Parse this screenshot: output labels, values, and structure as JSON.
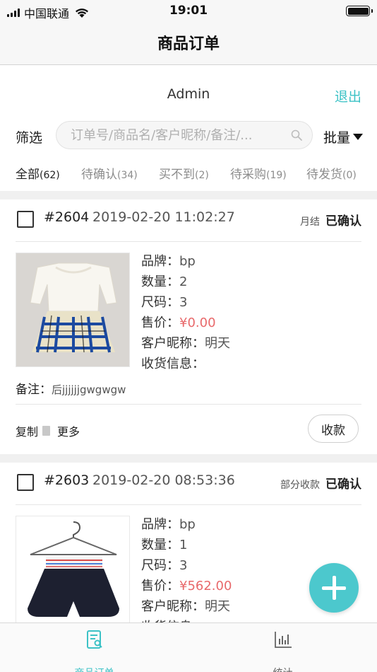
{
  "status_bar": {
    "carrier": "中国联通",
    "time": "19:01"
  },
  "nav": {
    "title": "商品订单"
  },
  "user": {
    "name": "Admin",
    "logout": "退出"
  },
  "filter": {
    "label": "筛选",
    "search_placeholder": "订单号/商品名/客户昵称/备注/...",
    "batch": "批量"
  },
  "tabs": [
    {
      "label": "全部",
      "count": "(62)"
    },
    {
      "label": "待确认",
      "count": "(34)"
    },
    {
      "label": "买不到",
      "count": "(2)"
    },
    {
      "label": "待采购",
      "count": "(19)"
    },
    {
      "label": "待发货",
      "count": "(0)"
    }
  ],
  "labels": {
    "brand": "品牌：",
    "qty": "数量：",
    "size": "尺码：",
    "price": "售价：",
    "nickname": "客户昵称：",
    "shipping": "收货信息：",
    "remark": "备注：",
    "copy": "复制",
    "more": "更多",
    "collect": "收款"
  },
  "orders": [
    {
      "no": "#2604",
      "time": "2019-02-20 11:02:27",
      "pay_type": "月结",
      "status": "已确认",
      "brand": "bp",
      "qty": "2",
      "size": "3",
      "price": "¥0.00",
      "nickname": "明天",
      "remark": "后jjjjjjgwgwgw"
    },
    {
      "no": "#2603",
      "time": "2019-02-20 08:53:36",
      "pay_type": "部分收款",
      "status": "已确认",
      "brand": "bp",
      "qty": "1",
      "size": "3",
      "price": "¥562.00",
      "nickname": "明天"
    }
  ],
  "tabbar": [
    {
      "label": "商品订单",
      "active": true
    },
    {
      "label": "统计",
      "active": false
    }
  ],
  "colors": {
    "accent": "#3cc2c6",
    "price": "#e8696b",
    "fab": "#4cc8cd"
  }
}
